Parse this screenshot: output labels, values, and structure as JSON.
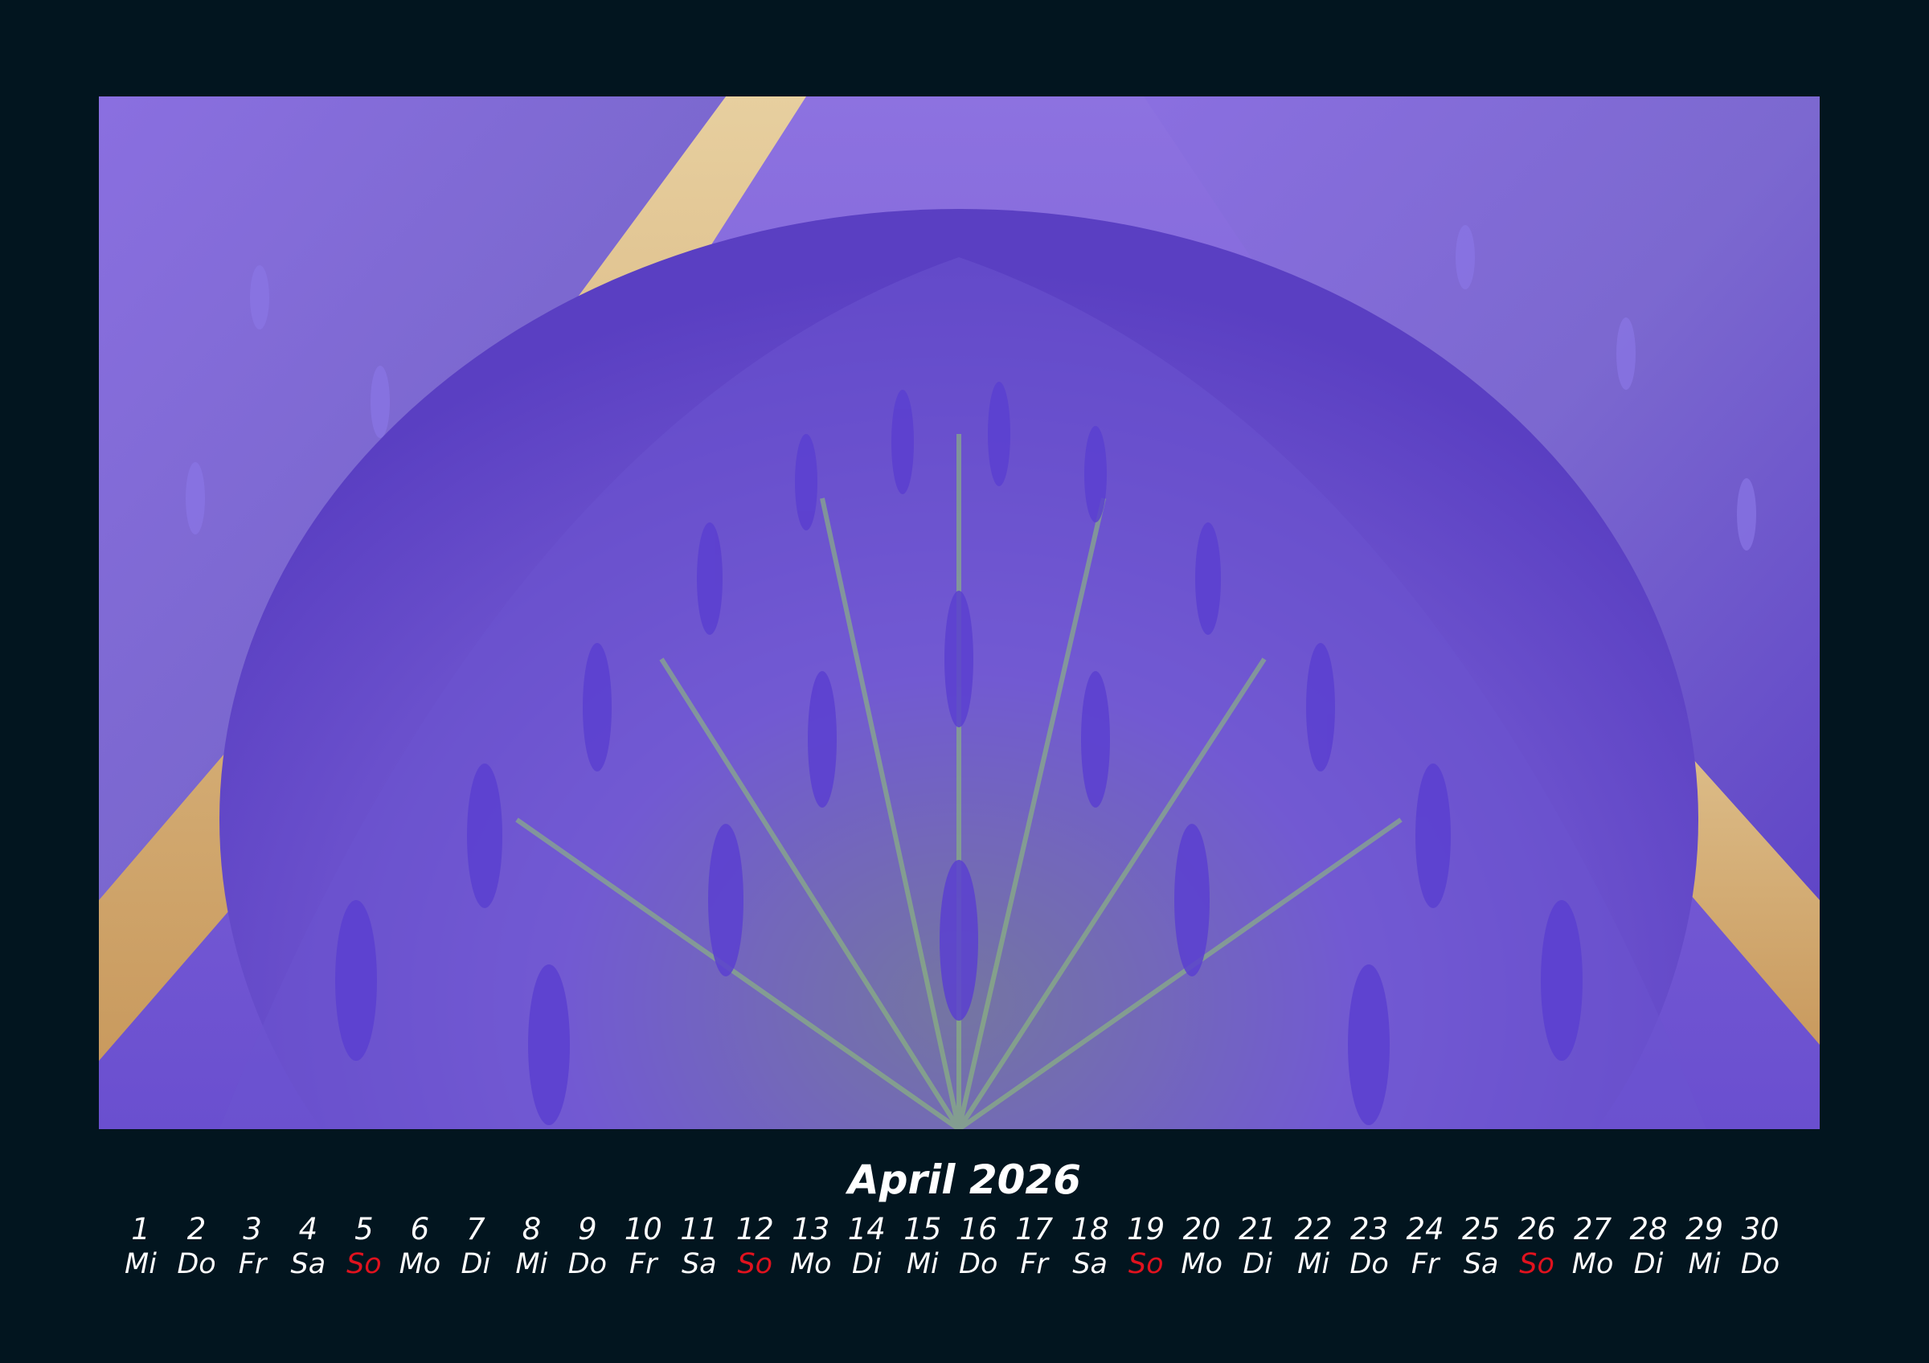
{
  "calendar": {
    "month_title": "April 2026",
    "sunday_color": "#e0121e",
    "photo_subject": "lavender field rows",
    "days": [
      {
        "day": "1",
        "weekday": "Mi"
      },
      {
        "day": "2",
        "weekday": "Do"
      },
      {
        "day": "3",
        "weekday": "Fr"
      },
      {
        "day": "4",
        "weekday": "Sa"
      },
      {
        "day": "5",
        "weekday": "So",
        "sunday": true
      },
      {
        "day": "6",
        "weekday": "Mo"
      },
      {
        "day": "7",
        "weekday": "Di"
      },
      {
        "day": "8",
        "weekday": "Mi"
      },
      {
        "day": "9",
        "weekday": "Do"
      },
      {
        "day": "10",
        "weekday": "Fr"
      },
      {
        "day": "11",
        "weekday": "Sa"
      },
      {
        "day": "12",
        "weekday": "So",
        "sunday": true
      },
      {
        "day": "13",
        "weekday": "Mo"
      },
      {
        "day": "14",
        "weekday": "Di"
      },
      {
        "day": "15",
        "weekday": "Mi"
      },
      {
        "day": "16",
        "weekday": "Do"
      },
      {
        "day": "17",
        "weekday": "Fr"
      },
      {
        "day": "18",
        "weekday": "Sa"
      },
      {
        "day": "19",
        "weekday": "So",
        "sunday": true
      },
      {
        "day": "20",
        "weekday": "Mo"
      },
      {
        "day": "21",
        "weekday": "Di"
      },
      {
        "day": "22",
        "weekday": "Mi"
      },
      {
        "day": "23",
        "weekday": "Do"
      },
      {
        "day": "24",
        "weekday": "Fr"
      },
      {
        "day": "25",
        "weekday": "Sa"
      },
      {
        "day": "26",
        "weekday": "So",
        "sunday": true
      },
      {
        "day": "27",
        "weekday": "Mo"
      },
      {
        "day": "28",
        "weekday": "Di"
      },
      {
        "day": "29",
        "weekday": "Mi"
      },
      {
        "day": "30",
        "weekday": "Do"
      }
    ]
  }
}
